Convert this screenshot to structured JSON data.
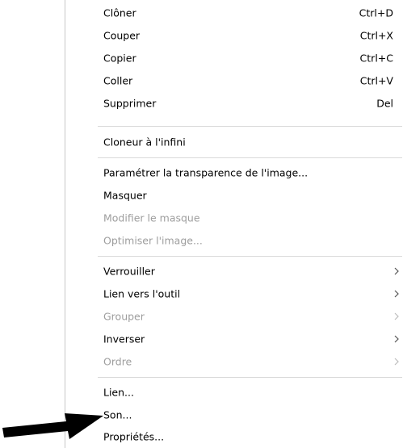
{
  "menu": {
    "items": [
      {
        "label": "Clôner",
        "shortcut": "Ctrl+D",
        "disabled": false
      },
      {
        "label": "Couper",
        "shortcut": "Ctrl+X",
        "disabled": false
      },
      {
        "label": "Copier",
        "shortcut": "Ctrl+C",
        "disabled": false
      },
      {
        "label": "Coller",
        "shortcut": "Ctrl+V",
        "disabled": false
      },
      {
        "label": "Supprimer",
        "shortcut": "Del",
        "disabled": false
      },
      {
        "label": "Cloneur à l'infini",
        "disabled": false
      },
      {
        "label": "Paramétrer la transparence de l'image...",
        "disabled": false
      },
      {
        "label": "Masquer",
        "disabled": false
      },
      {
        "label": "Modifier le masque",
        "disabled": true
      },
      {
        "label": "Optimiser l'image...",
        "disabled": true
      },
      {
        "label": "Verrouiller",
        "submenu": true,
        "disabled": false
      },
      {
        "label": "Lien vers l'outil",
        "submenu": true,
        "disabled": false
      },
      {
        "label": "Grouper",
        "submenu": true,
        "disabled": true
      },
      {
        "label": "Inverser",
        "submenu": true,
        "disabled": false
      },
      {
        "label": "Ordre",
        "submenu": true,
        "disabled": true
      },
      {
        "label": "Lien...",
        "disabled": false
      },
      {
        "label": "Son...",
        "disabled": false
      },
      {
        "label": "Propriétés...",
        "disabled": false
      }
    ]
  },
  "colors": {
    "text": "#000000",
    "disabled_text": "#9e9e9e",
    "separator": "#d9d9d9",
    "arrow": "#000000"
  },
  "icons": {
    "submenu": "chevron-right-icon",
    "pointer": "arrow-pointer-icon"
  }
}
